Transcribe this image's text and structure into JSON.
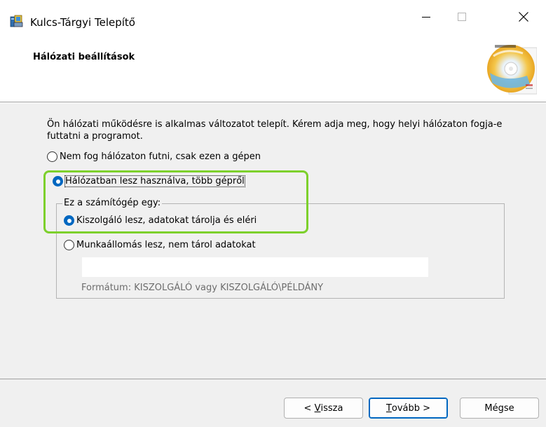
{
  "window": {
    "title": "Kulcs-Tárgyi Telepítő",
    "icon": "installer-icon"
  },
  "header": {
    "title": "Hálózati beállítások",
    "graphic": "cd-disc-icon"
  },
  "content": {
    "description": "Ön hálózati működésre is alkalmas változatot telepít. Kérem adja meg, hogy helyi hálózaton fogja-e futtatni a programot.",
    "mode_options": [
      {
        "label": "Nem fog hálózaton futni, csak ezen a gépen",
        "checked": false
      },
      {
        "label": "Hálózatban lesz használva, több gépről",
        "checked": true
      }
    ],
    "computer_group": {
      "legend": "Ez a számítógép egy:",
      "options": [
        {
          "label": "Kiszolgáló lesz, adatokat tárolja és eléri",
          "checked": true
        },
        {
          "label": "Munkaállomás lesz, nem tárol adatokat",
          "checked": false
        }
      ],
      "server_input_value": "",
      "format_hint": "Formátum: KISZOLGÁLÓ vagy KISZOLGÁLÓ\\PÉLDÁNY"
    }
  },
  "buttons": {
    "back": {
      "prefix": "< ",
      "mnemonic": "V",
      "rest": "issza"
    },
    "next": {
      "mnemonic": "T",
      "rest": "ovább >"
    },
    "cancel": "Mégse"
  },
  "colors": {
    "accent": "#0067c0",
    "highlight": "#7dd02c",
    "panel": "#f0f0f0"
  }
}
